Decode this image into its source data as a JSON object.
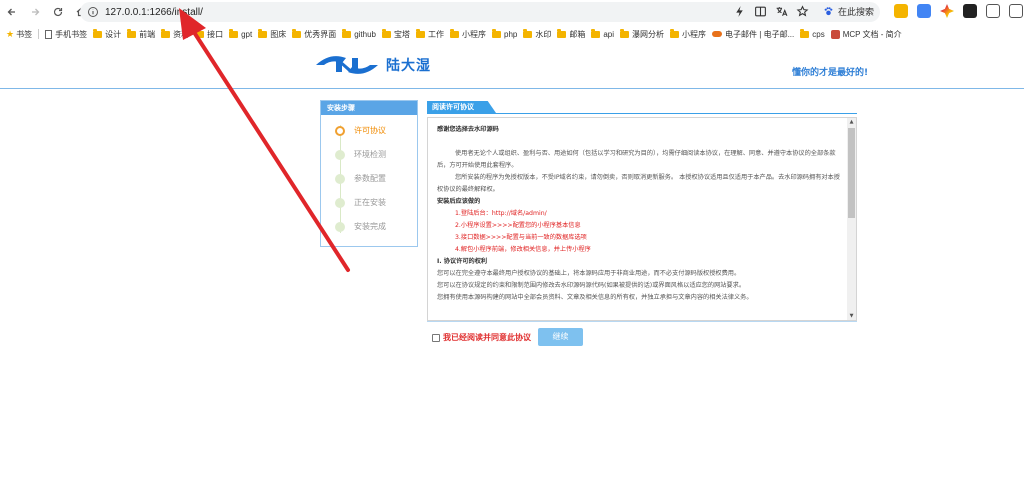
{
  "browser": {
    "url": "127.0.0.1:1266/install/",
    "search_engine_label": "在此搜索",
    "bookmarks": [
      {
        "type": "star",
        "label": "书签"
      },
      {
        "type": "doc",
        "label": "手机书签"
      },
      {
        "type": "folder",
        "label": "设计"
      },
      {
        "type": "folder",
        "label": "前端"
      },
      {
        "type": "folder",
        "label": "资料"
      },
      {
        "type": "folder",
        "label": "接口"
      },
      {
        "type": "folder",
        "label": "gpt"
      },
      {
        "type": "folder",
        "label": "图床"
      },
      {
        "type": "folder",
        "label": "优秀界面"
      },
      {
        "type": "folder",
        "label": "github"
      },
      {
        "type": "folder",
        "label": "宝塔"
      },
      {
        "type": "folder",
        "label": "工作"
      },
      {
        "type": "folder",
        "label": "小程序"
      },
      {
        "type": "folder",
        "label": "php"
      },
      {
        "type": "folder",
        "label": "水印"
      },
      {
        "type": "folder",
        "label": "邮箱"
      },
      {
        "type": "folder",
        "label": "api"
      },
      {
        "type": "folder",
        "label": "瀑网分析"
      },
      {
        "type": "folder",
        "label": "小程序"
      },
      {
        "type": "cloud",
        "label": "电子邮件 | 电子邮..."
      },
      {
        "type": "folder",
        "label": "cps"
      },
      {
        "type": "mcp",
        "label": "MCP 文档 - 简介"
      }
    ]
  },
  "header": {
    "logo_text": "陆大湿",
    "slogan": "懂你的才是最好的!"
  },
  "steps": {
    "title": "安装步骤",
    "items": [
      {
        "label": "许可协议",
        "active": true
      },
      {
        "label": "环境检测",
        "active": false
      },
      {
        "label": "参数配置",
        "active": false
      },
      {
        "label": "正在安装",
        "active": false
      },
      {
        "label": "安装完成",
        "active": false
      }
    ]
  },
  "agreement": {
    "tab_label": "阅读许可协议",
    "intro": "感谢您选择去水印源码",
    "para1": "使用者无论个人或组织、盈利与否、用途如何（包括以学习和研究为目的），均需仔细阅读本协议，在理解、同意、并遵守本协议的全部条款后，方可开始使用此套程序。",
    "para2": "您所安装的程序为免授权版本，不受IP域名约束，请勿倒卖，否则取消更新服务。 本授权协议适用且仅适用于本产品。去水印源码拥有对本授权协议的最终解释权。",
    "after_install_title": "安装后应该做的",
    "after_install_steps": [
      "1.登陆后台：http://域名/admin/",
      "2.小程序设置>>>>配置您的小程序基本信息",
      "3.接口数据>>>>配置与当前一致的数据库选项",
      "4.解包小程序前端，修改相关信息，并上传小程序"
    ],
    "rights_title": "I. 协议许可的权利",
    "rights": [
      "您可以在完全遵守本最终用户授权协议的基础上，将本源码应用于非商业用途，而不必支付源码版权授权费用。",
      "您可以在协议规定的约束和限制范围内修改去水印源码源代码(如果被提供的话)或界面风格以适应您的网站要求。",
      "您拥有使用本源码构建的网站中全部会员资料、文章及相关信息的所有权，并独立承担与文章内容的相关法律义务。"
    ]
  },
  "accept_label": "我已经阅读并同意此协议",
  "continue_label": "继续",
  "colors": {
    "accent": "#3aa0e8",
    "step_active": "#f08a00",
    "warning_text": "#e02020",
    "annotation_arrow": "#e0262a"
  }
}
